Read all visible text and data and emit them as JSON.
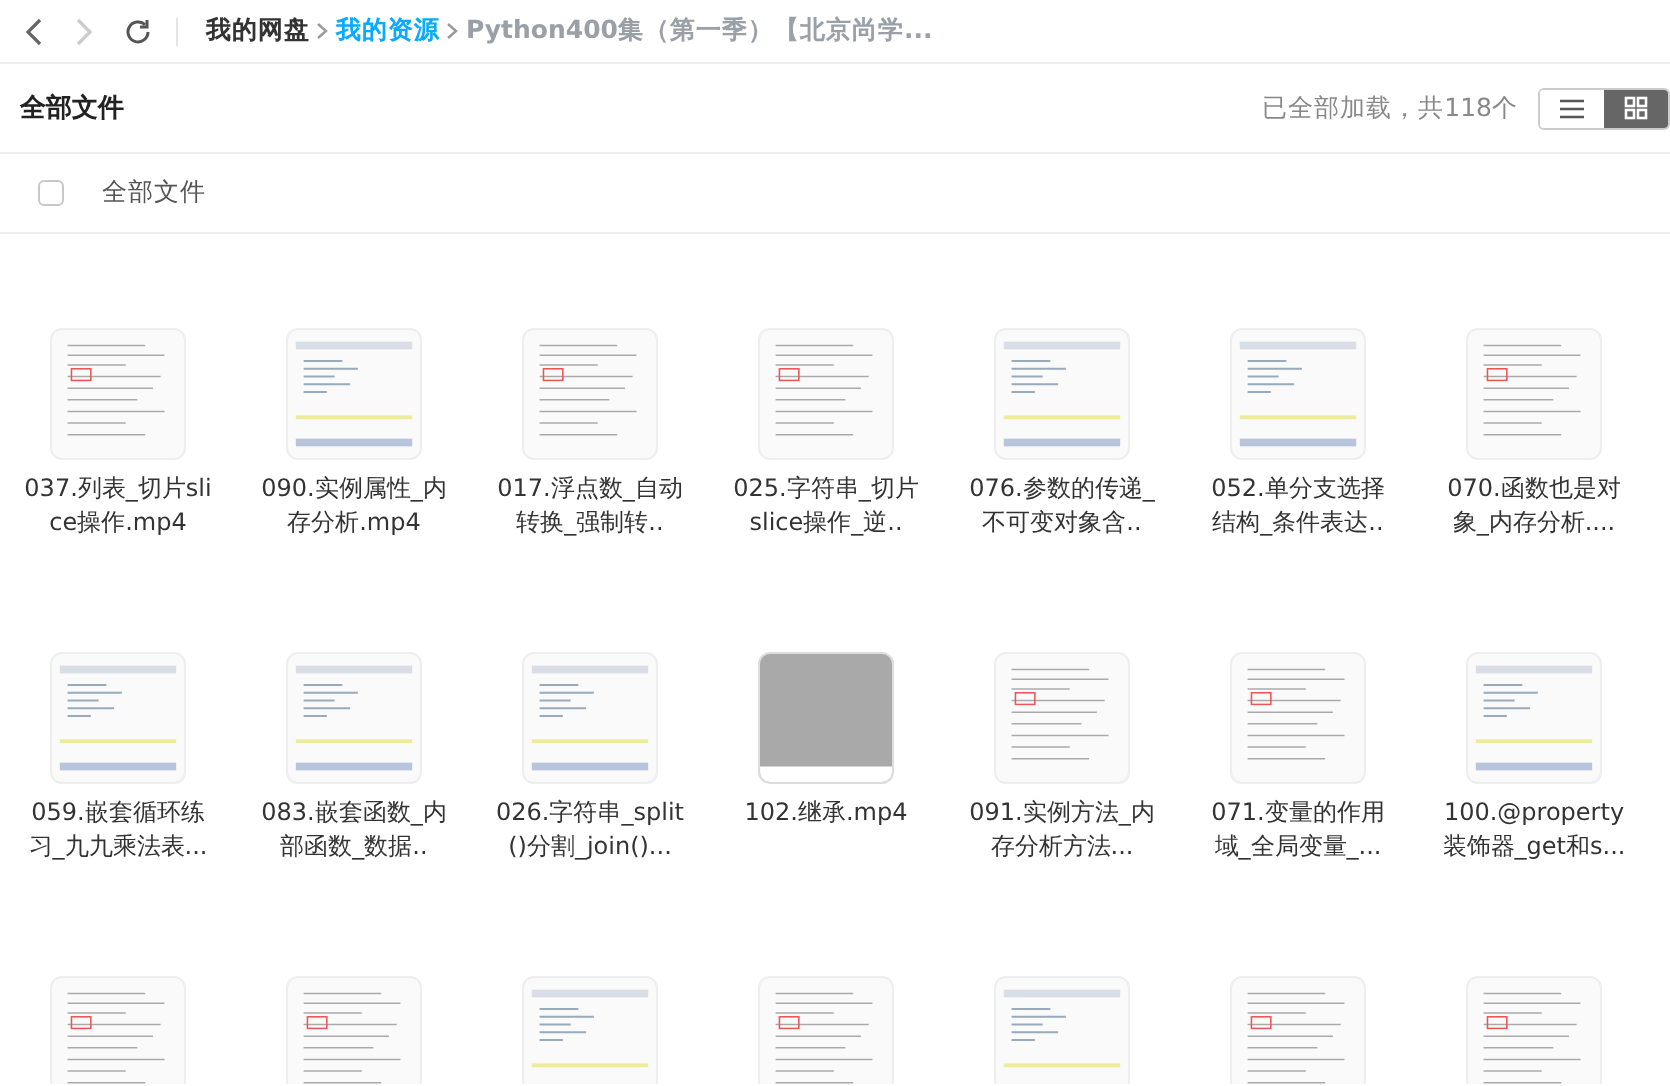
{
  "nav": {
    "back_disabled": false,
    "forward_disabled": true
  },
  "breadcrumb": [
    {
      "label": "我的网盘",
      "kind": "root"
    },
    {
      "label": "我的资源",
      "kind": "link"
    },
    {
      "label": "Python400集（第一季）【北京尚学...",
      "kind": "current"
    }
  ],
  "header": {
    "title": "全部文件",
    "status": "已全部加载，共118个",
    "view_modes": [
      {
        "kind": "list",
        "selected": false
      },
      {
        "kind": "grid",
        "selected": true
      }
    ]
  },
  "select_all": {
    "label": "全部文件",
    "checked": false
  },
  "files": [
    {
      "name": "037.列表_切片slice操作.mp4",
      "kind": "doc"
    },
    {
      "name": "090.实例属性_内存分析.mp4",
      "kind": "code"
    },
    {
      "name": "017.浮点数_自动转换_强制转..",
      "kind": "doc"
    },
    {
      "name": "025.字符串_切片slice操作_逆..",
      "kind": "doc"
    },
    {
      "name": "076.参数的传递_不可变对象含..",
      "kind": "code"
    },
    {
      "name": "052.单分支选择结构_条件表达..",
      "kind": "code"
    },
    {
      "name": "070.函数也是对象_内存分析....",
      "kind": "doc"
    },
    {
      "name": "059.嵌套循环练习_九九乘法表...",
      "kind": "code"
    },
    {
      "name": "083.嵌套函数_内部函数_数据..",
      "kind": "code"
    },
    {
      "name": "026.字符串_split()分割_join()...",
      "kind": "code"
    },
    {
      "name": "102.继承.mp4",
      "kind": "blank"
    },
    {
      "name": "091.实例方法_内存分析方法...",
      "kind": "doc"
    },
    {
      "name": "071.变量的作用域_全局变量_...",
      "kind": "doc"
    },
    {
      "name": "100.@property装饰器_get和s...",
      "kind": "code"
    },
    {
      "kind": "doc"
    },
    {
      "kind": "doc"
    },
    {
      "kind": "code"
    },
    {
      "kind": "doc"
    },
    {
      "kind": "code"
    },
    {
      "kind": "doc"
    },
    {
      "kind": "doc"
    }
  ]
}
